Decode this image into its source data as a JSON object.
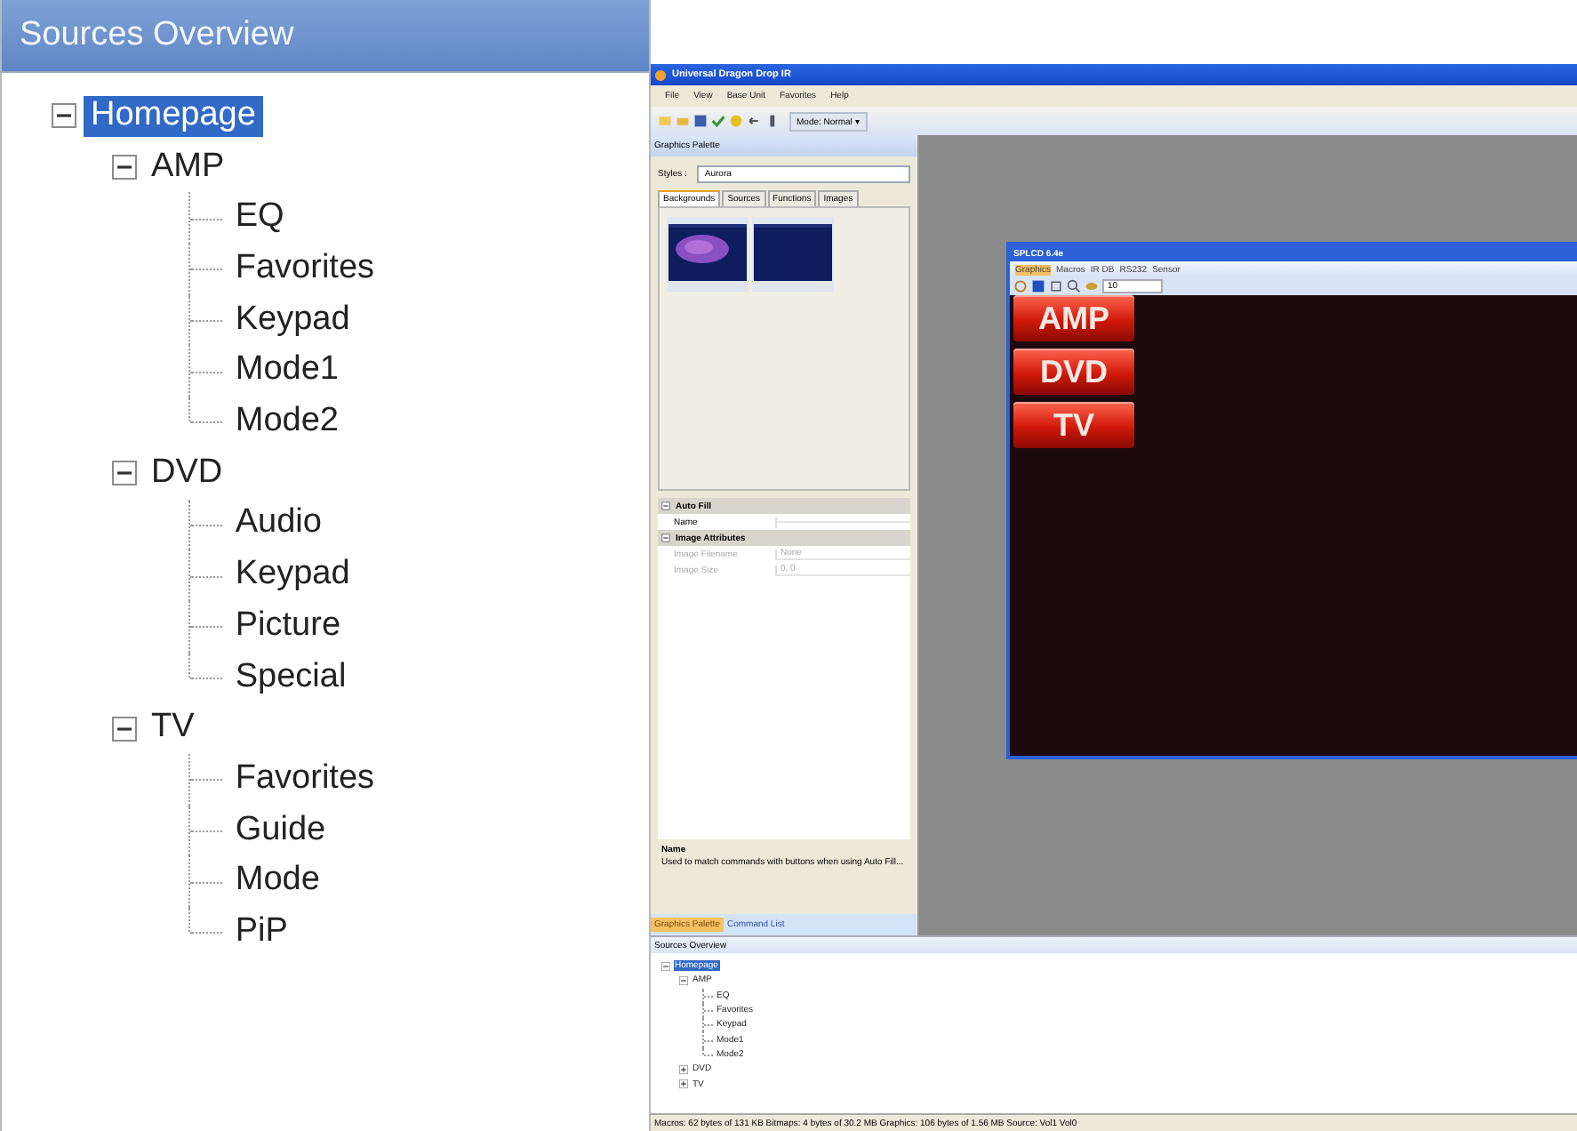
{
  "overview_panel": {
    "title": "Sources Overview",
    "tree": [
      {
        "label": "Homepage",
        "selected": true,
        "expanded": true,
        "children": [
          {
            "label": "AMP",
            "selected": false,
            "expanded": true,
            "children": [
              {
                "label": "EQ",
                "selected": false
              },
              {
                "label": "Favorites",
                "selected": false
              },
              {
                "label": "Keypad",
                "selected": false
              },
              {
                "label": "Mode1",
                "selected": false
              },
              {
                "label": "Mode2",
                "selected": false
              }
            ]
          },
          {
            "label": "DVD",
            "selected": false,
            "expanded": true,
            "children": [
              {
                "label": "Audio",
                "selected": false
              },
              {
                "label": "Keypad",
                "selected": false
              },
              {
                "label": "Picture",
                "selected": false
              },
              {
                "label": "Special",
                "selected": false
              }
            ]
          },
          {
            "label": "TV",
            "selected": false,
            "expanded": true,
            "children": [
              {
                "label": "Favorites",
                "selected": false
              },
              {
                "label": "Guide",
                "selected": false
              },
              {
                "label": "Mode",
                "selected": false
              },
              {
                "label": "PiP",
                "selected": false
              }
            ]
          }
        ]
      }
    ]
  },
  "app_window": {
    "title": "Universal Dragon Drop IR",
    "menu": [
      "File",
      "View",
      "Base Unit",
      "Favorites",
      "Help"
    ],
    "toolbar": {
      "mode": "Mode: Normal ▾"
    },
    "palette": {
      "title": "Graphics Palette",
      "styles_label": "Styles :",
      "styles_value": "Aurora",
      "tabs": [
        {
          "label": "Backgrounds",
          "selected": true
        },
        {
          "label": "Sources",
          "selected": false
        },
        {
          "label": "Functions",
          "selected": false
        },
        {
          "label": "Images",
          "selected": false
        }
      ],
      "properties": [
        {
          "kind": "category",
          "label": "Auto Fill",
          "expanded": true
        },
        {
          "kind": "property",
          "label": "Name",
          "disabled": false
        },
        {
          "kind": "category",
          "label": "Image Attributes",
          "expanded": true
        },
        {
          "kind": "property",
          "label": "Image Filename",
          "value": "None",
          "disabled": true
        },
        {
          "kind": "property",
          "label": "Image Size",
          "value": "0, 0",
          "disabled": true
        }
      ],
      "description_title": "Name",
      "description": "Used to match commands with buttons when using Auto Fill...",
      "bottom_tabs": [
        {
          "label": "Graphics Palette",
          "selected": true
        },
        {
          "label": "Command List",
          "selected": false
        }
      ]
    },
    "editor": {
      "title": "SPLCD 6.4e",
      "tabs": [
        {
          "label": "Graphics",
          "selected": true
        },
        {
          "label": "Macros",
          "selected": false
        },
        {
          "label": "IR DB",
          "selected": false
        },
        {
          "label": "RS232",
          "selected": false
        },
        {
          "label": "Sensor",
          "selected": false
        }
      ],
      "zoom": "10",
      "buttons": [
        "AMP",
        "DVD",
        "TV"
      ]
    },
    "sources_overview": {
      "title": "Sources Overview",
      "tree": [
        {
          "label": "Homepage",
          "selected": true,
          "expanded": true,
          "children": [
            {
              "label": "AMP",
              "selected": false,
              "expanded": true,
              "children": [
                {
                  "label": "EQ",
                  "selected": false
                },
                {
                  "label": "Favorites",
                  "selected": false
                },
                {
                  "label": "Keypad",
                  "selected": false
                },
                {
                  "label": "Mode1",
                  "selected": false
                },
                {
                  "label": "Mode2",
                  "selected": false
                }
              ]
            },
            {
              "label": "DVD",
              "selected": false,
              "expanded": false
            },
            {
              "label": "TV",
              "selected": false,
              "expanded": false
            }
          ]
        }
      ]
    },
    "status_bar": "Macros: 62 bytes of 131 KB  Bitmaps: 4 bytes of 30.2 MB  Graphics: 106 bytes of 1.56 MB  Source: Vol1  Vol0"
  }
}
